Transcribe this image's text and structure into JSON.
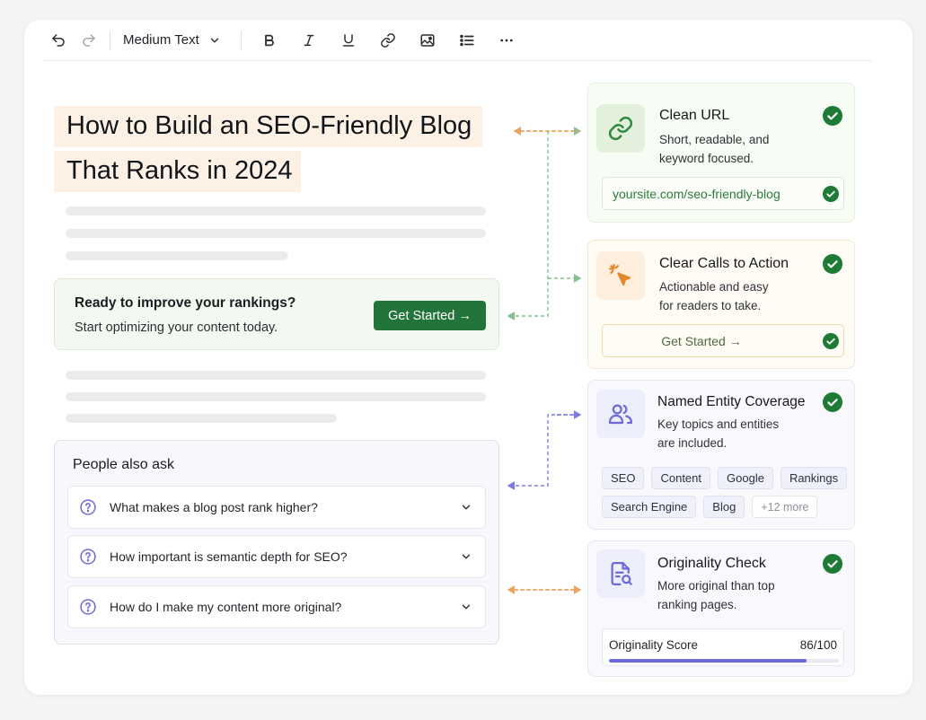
{
  "toolbar": {
    "text_style": "Medium Text",
    "icons": [
      "undo-icon",
      "redo-icon",
      "bold-icon",
      "italic-icon",
      "underline-icon",
      "link-icon",
      "image-icon",
      "list-icon",
      "more-icon"
    ]
  },
  "article": {
    "title_line1": "How to Build an SEO-Friendly Blog",
    "title_line2": "That Ranks in 2024"
  },
  "cta_box": {
    "title": "Ready to improve your rankings?",
    "subtitle": "Start optimizing your content today.",
    "button_label": "Get Started →"
  },
  "people_also_ask": {
    "title": "People also ask",
    "questions": [
      "What makes a blog post rank higher?",
      "How important is semantic depth for SEO?",
      "How do I make my content more original?"
    ]
  },
  "checks": {
    "clean_url": {
      "title": "Clean URL",
      "desc_line1": "Short, readable, and",
      "desc_line2": "keyword focused.",
      "url": "yoursite.com/seo-friendly-blog"
    },
    "cta": {
      "title": "Clear Calls to Action",
      "desc_line1": "Actionable and easy",
      "desc_line2": "for readers to take.",
      "button_label": "Get Started →"
    },
    "entities": {
      "title": "Named Entity Coverage",
      "desc_line1": "Key topics and entities",
      "desc_line2": "are included.",
      "tags": [
        "SEO",
        "Content",
        "Google",
        "Rankings",
        "Search Engine",
        "Blog"
      ],
      "more": "+12 more"
    },
    "originality": {
      "title": "Originality Check",
      "desc_line1": "More original than top",
      "desc_line2": "ranking pages.",
      "score_label": "Originality Score",
      "score_value": "86/100",
      "score_fraction": 0.86
    }
  },
  "colors": {
    "green": "#22753a",
    "check_green": "#1f7a35",
    "orange": "#e2882a",
    "purple": "#6c6ad6"
  }
}
